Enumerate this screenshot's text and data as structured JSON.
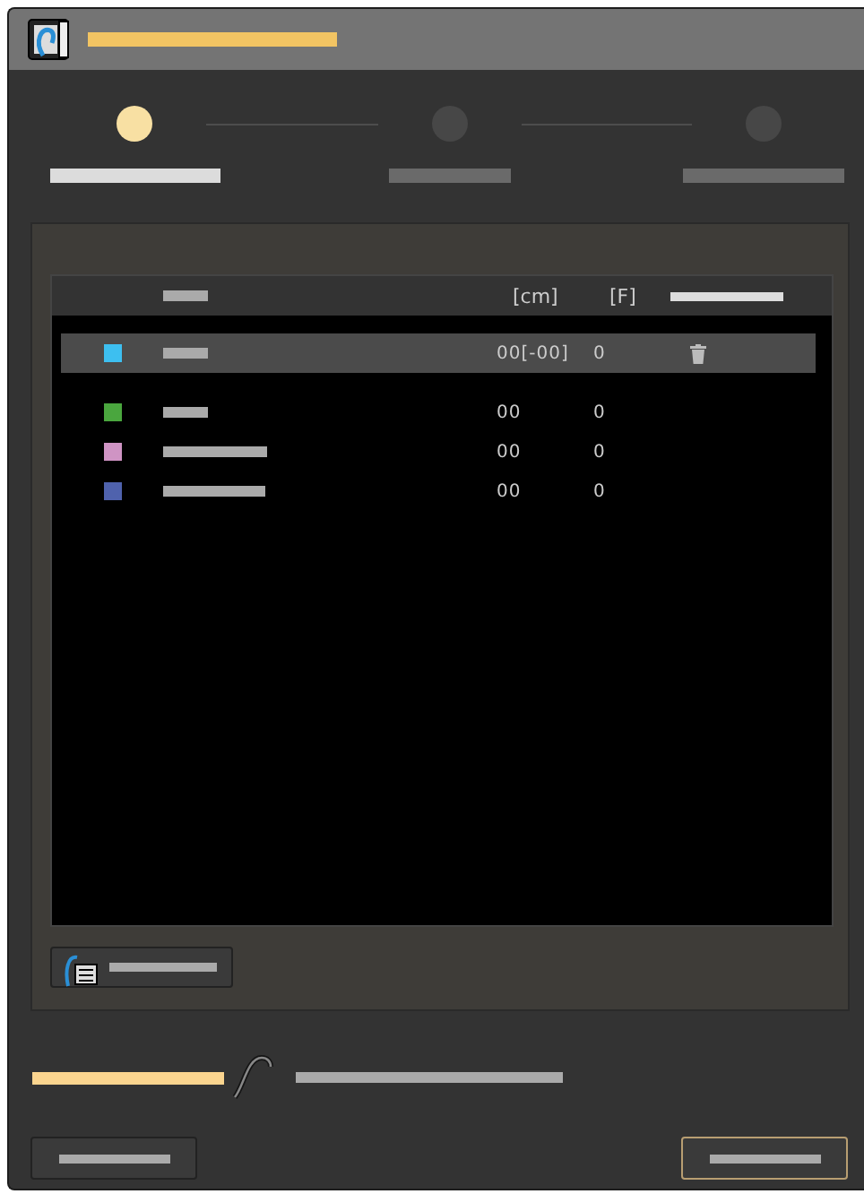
{
  "steps": [
    {
      "selected": true
    },
    {
      "selected": false
    },
    {
      "selected": false
    }
  ],
  "table": {
    "columns": [
      "[cm]",
      "[F]"
    ],
    "rows": [
      {
        "color": "#3dbff0",
        "size": "00[-00]",
        "f": "0",
        "selected": true
      },
      {
        "color": "#4aa63e",
        "size": "00",
        "f": "0",
        "selected": false
      },
      {
        "color": "#cf94c4",
        "size": "00",
        "f": "0",
        "selected": false
      },
      {
        "color": "#4f62ad",
        "size": "00",
        "f": "0",
        "selected": false
      }
    ]
  }
}
